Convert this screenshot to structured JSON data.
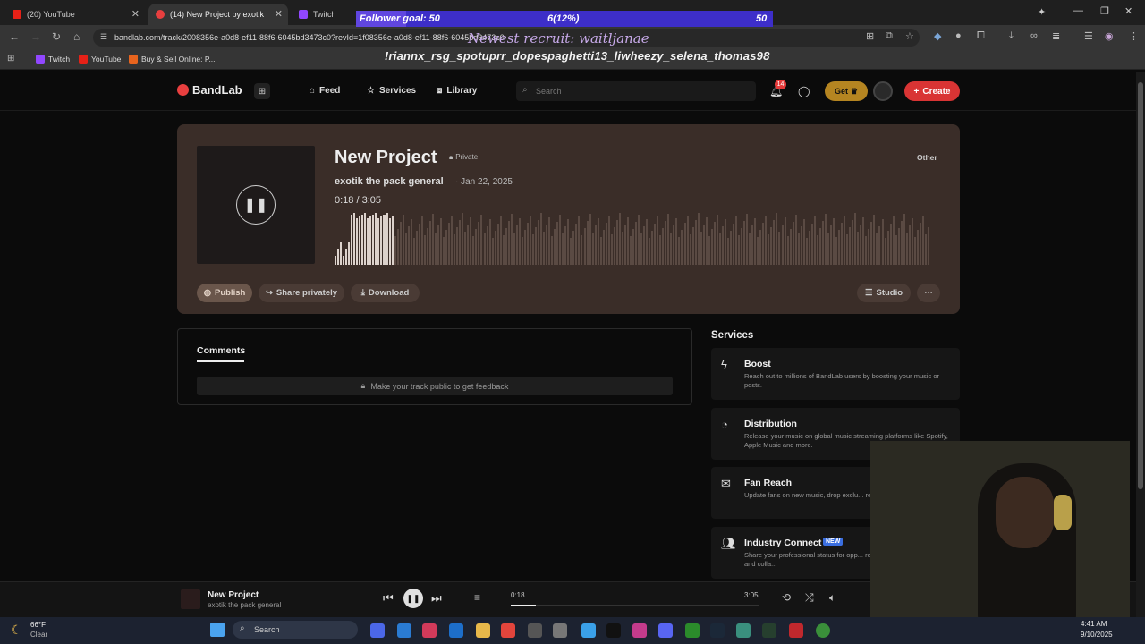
{
  "browser": {
    "tabs": [
      {
        "label": "(20) YouTube",
        "color": "#e62117"
      },
      {
        "label": "(14) New Project by exotik",
        "color": "#e83f3f"
      },
      {
        "label": "Twitch",
        "color": "#9147ff"
      }
    ],
    "url": "bandlab.com/track/2008356e-a0d8-ef11-88f6-6045bd3473c0?revId=1f08356e-a0d8-ef11-88f6-6045bd3473c0",
    "bookmarks": [
      {
        "label": "Twitch",
        "color": "#9147ff"
      },
      {
        "label": "YouTube",
        "color": "#e62117"
      },
      {
        "label": "Buy & Sell Online: P...",
        "color": "#e8641e"
      }
    ]
  },
  "overlay": {
    "goal_label": "Follower goal: 50",
    "goal_progress": "6(12%)",
    "goal_target": "50",
    "recruit": "Newest recruit: waitljanae",
    "names": "!riannx_rsg_spotuprr_dopespaghetti13_liwheezy_selena_thomas98"
  },
  "bandlab": {
    "logo": "BandLab",
    "nav": [
      "Feed",
      "Services",
      "Library"
    ],
    "search_placeholder": "Search",
    "notif_count": "14",
    "get_label": "Get",
    "create_label": "Create"
  },
  "track": {
    "title": "New Project",
    "privacy": "Private",
    "artist": "exotik the pack general",
    "date": "· Jan 22, 2025",
    "time": "0:18 /  3:05",
    "genre": "Other",
    "publish": "Publish",
    "share": "Share privately",
    "download": "Download",
    "studio": "Studio",
    "progress_fraction": 0.1
  },
  "comments": {
    "tab": "Comments",
    "feedback": "Make your track public to get feedback"
  },
  "services": {
    "heading": "Services",
    "items": [
      {
        "title": "Boost",
        "desc": "Reach out to millions of BandLab users by boosting your music or posts.",
        "icon": "bolt-icon"
      },
      {
        "title": "Distribution",
        "desc": "Release your music on global music streaming platforms like Spotify, Apple Music and more.",
        "icon": "distribution-icon"
      },
      {
        "title": "Fan Reach",
        "desc": "Update fans on new music, drop exclu... reach out to connect.",
        "icon": "mail-icon"
      },
      {
        "title": "Industry Connect",
        "badge": "NEW",
        "desc": "Share your professional status for opp... representation, record deals and colla...",
        "icon": "people-icon"
      }
    ]
  },
  "player": {
    "title": "New Project",
    "artist": "exotik the pack general",
    "current": "0:18",
    "total": "3:05"
  },
  "taskbar": {
    "weather_temp": "66°F",
    "weather_desc": "Clear",
    "search": "Search",
    "time": "4:41 AM",
    "date": "9/10/2025"
  }
}
